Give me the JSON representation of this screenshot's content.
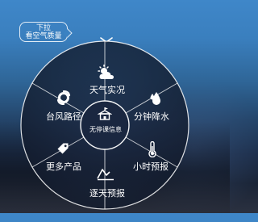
{
  "tooltip": {
    "line1": "下拉",
    "line2": "看空气质量"
  },
  "menu": {
    "center": {
      "label": "无停课信息",
      "icon": "school-building-icon"
    },
    "items": [
      {
        "label": "天气实况",
        "icon": "partly-cloudy-icon"
      },
      {
        "label": "分钟降水",
        "icon": "raindrop-icon"
      },
      {
        "label": "小时预报",
        "icon": "thermometer-icon"
      },
      {
        "label": "逐天预报",
        "icon": "trend-line-icon"
      },
      {
        "label": "更多产品",
        "icon": "tag-icon"
      },
      {
        "label": "台风路径",
        "icon": "typhoon-icon"
      }
    ]
  },
  "colors": {
    "ring": "#ffffff",
    "segment_fill": "#162238",
    "accent_blue": "#3b82c2"
  }
}
